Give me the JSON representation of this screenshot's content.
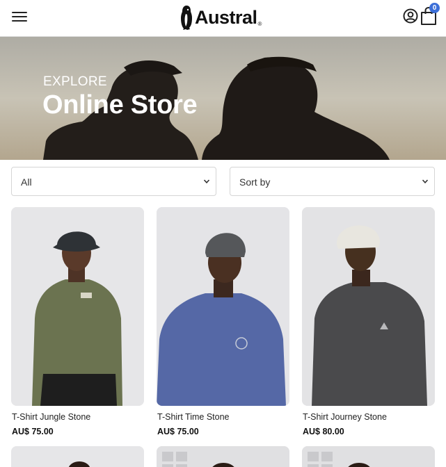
{
  "header": {
    "brand": "Austral",
    "brand_mark": "®",
    "cart_count": "0",
    "menu_icon": "hamburger-menu-icon",
    "user_icon": "user-circle-icon",
    "cart_icon": "shopping-bag-icon"
  },
  "hero": {
    "eyebrow": "EXPLORE",
    "title": "Online Store"
  },
  "filters": {
    "category": {
      "selected": "All"
    },
    "sort": {
      "selected": "Sort by"
    }
  },
  "products": [
    {
      "name": "T-Shirt Jungle Stone",
      "price": "AU$ 75.00",
      "shirt_color": "#6b7350",
      "hat_color": "#2e3236"
    },
    {
      "name": "T-Shirt Time Stone",
      "price": "AU$ 75.00",
      "shirt_color": "#5568a6",
      "hat_color": "#55575a"
    },
    {
      "name": "T-Shirt Journey Stone",
      "price": "AU$ 80.00",
      "shirt_color": "#4a4a4c",
      "hat_color": "#e8e6df"
    }
  ],
  "colors": {
    "accent": "#3c6fd8",
    "text": "#222222",
    "border": "#d5d5d5"
  }
}
